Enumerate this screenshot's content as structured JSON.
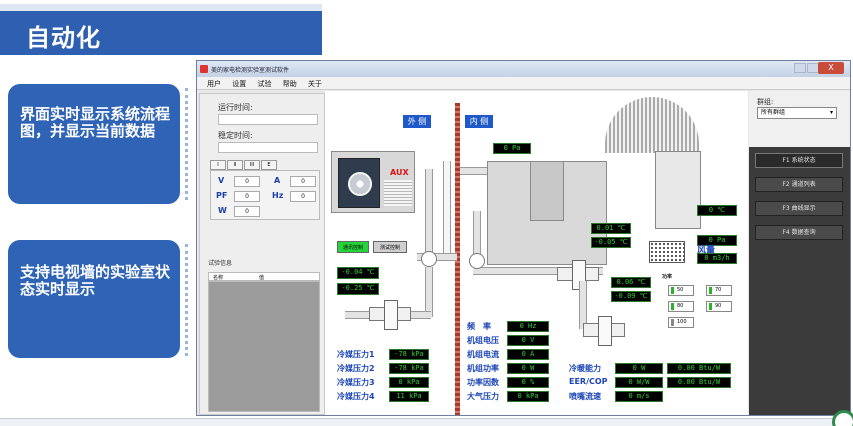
{
  "slide": {
    "title": "自动化",
    "callout1": "界面实时显示系统流程图，并显示当前数据",
    "callout2": "支持电视墙的实验室状态实时显示"
  },
  "window": {
    "title": "美的家电检测实验室测试软件",
    "close": "X",
    "menu": [
      "用户",
      "设置",
      "试验",
      "帮助",
      "关于"
    ]
  },
  "left_panel": {
    "run_time_label": "运行时间:",
    "stable_time_label": "稳定时间:",
    "tabs": [
      "I",
      "II",
      "III",
      "E"
    ],
    "meters": [
      {
        "label": "V",
        "value": "0"
      },
      {
        "label": "A",
        "value": "0"
      },
      {
        "label": "PF",
        "value": "0"
      },
      {
        "label": "Hz",
        "value": "0"
      },
      {
        "label": "W",
        "value": "0"
      }
    ],
    "info_label": "试验信息",
    "grid_headers": [
      "名称",
      "值"
    ]
  },
  "canvas": {
    "outside_label": "外 侧",
    "inside_label": "内 侧",
    "brand": "AUX",
    "btn_start": "通讯控制",
    "btn_stop": "测试控制",
    "readouts": {
      "pa_top": "0 Pa",
      "t_in1": "0.01 ℃",
      "t_in2": "-0.05 ℃",
      "t_top_right": "0 ℃",
      "pa_right": "0 Pa",
      "airflow": "0 m3/h",
      "t_out1": "-0.04 ℃",
      "t_out2": "-0.25 ℃",
      "t_mid1": "0.06 ℃",
      "t_mid2": "-0.09 ℃"
    },
    "airflow_label": "风量",
    "legend_title": "功率",
    "legend_items": [
      "50",
      "70",
      "80",
      "90",
      "100"
    ],
    "pressures": [
      {
        "label": "冷媒压力1",
        "value": "-78 kPa"
      },
      {
        "label": "冷媒压力2",
        "value": "-78 kPa"
      },
      {
        "label": "冷媒压力3",
        "value": "0 kPa"
      },
      {
        "label": "冷媒压力4",
        "value": "11 kPa"
      }
    ],
    "unit_params": [
      {
        "label": "频　率",
        "value": "0 Hz"
      },
      {
        "label": "机组电压",
        "value": "0 V"
      },
      {
        "label": "机组电流",
        "value": "0 A"
      },
      {
        "label": "机组功率",
        "value": "0 W"
      },
      {
        "label": "功率因数",
        "value": "0 %"
      },
      {
        "label": "大气压力",
        "value": "0 kPa"
      }
    ],
    "capacity": [
      {
        "label": "冷暖能力",
        "value1": "0 W",
        "value2": "0.00 Btu/W"
      },
      {
        "label": "EER/COP",
        "value1": "0 W/W",
        "value2": "0.00 Btu/W"
      },
      {
        "label": "喷嘴流速",
        "value1": "0 m/s",
        "value2": ""
      }
    ]
  },
  "right_panel": {
    "group_label": "群组:",
    "group_value": "所有群组",
    "buttons": [
      "F1 系统状态",
      "F2 通道列表",
      "F3 曲线显示",
      "F4 数据查询"
    ]
  },
  "colors": {
    "banner": "#2f5fb0",
    "callout": "#2f63b6",
    "lcd_text": "#2fd12f",
    "label_blue": "#1b45b8"
  }
}
